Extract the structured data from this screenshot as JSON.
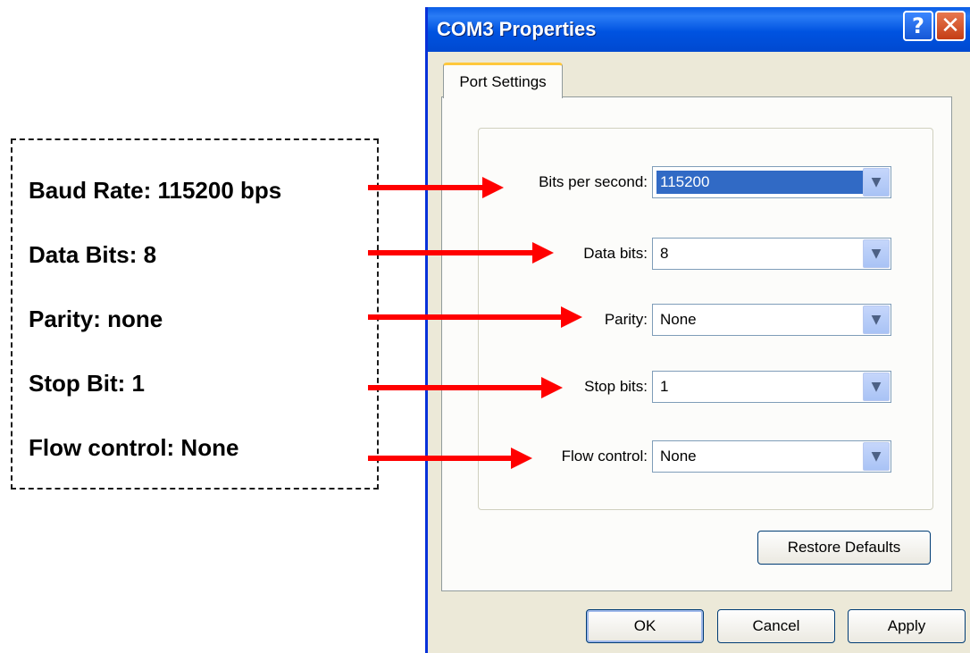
{
  "annotations": {
    "items": [
      {
        "label": "Baud Rate: 115200 bps"
      },
      {
        "label": "Data Bits: 8"
      },
      {
        "label": "Parity: none"
      },
      {
        "label": "Stop Bit: 1"
      },
      {
        "label": "Flow control: None"
      }
    ],
    "arrow_color": "#ff0000"
  },
  "dialog": {
    "title": "COM3 Properties",
    "help_glyph": "?",
    "close_glyph": "✕",
    "tab_label": "Port Settings",
    "fields": [
      {
        "label": "Bits per second:",
        "value": "115200",
        "icon": "chevron-down-icon"
      },
      {
        "label": "Data bits:",
        "value": "8",
        "icon": "chevron-down-icon"
      },
      {
        "label": "Parity:",
        "value": "None",
        "icon": "chevron-down-icon"
      },
      {
        "label": "Stop bits:",
        "value": "1",
        "icon": "chevron-down-icon"
      },
      {
        "label": "Flow control:",
        "value": "None",
        "icon": "chevron-down-icon"
      }
    ],
    "restore_label": "Restore Defaults",
    "ok_label": "OK",
    "cancel_label": "Cancel",
    "apply_label": "Apply",
    "title_bar_color": "#0054e3",
    "selection_color": "#316ac5"
  }
}
